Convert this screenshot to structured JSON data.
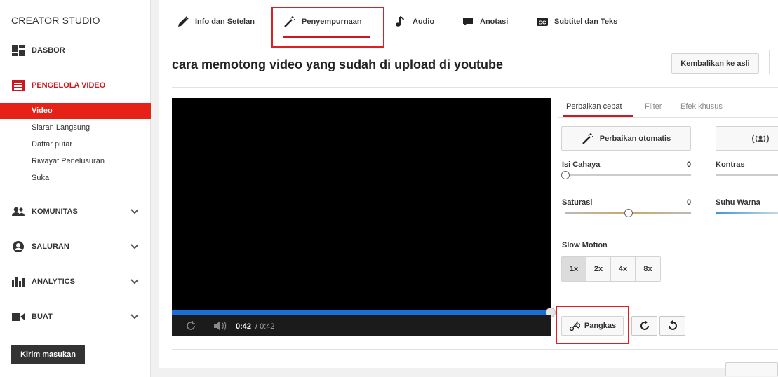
{
  "sidebar": {
    "brand": "CREATOR STUDIO",
    "items": [
      {
        "label": "DASBOR",
        "icon": "dashboard-icon"
      },
      {
        "label": "PENGELOLA VIDEO",
        "icon": "video-manager-icon"
      },
      {
        "label": "KOMUNITAS",
        "icon": "community-icon"
      },
      {
        "label": "SALURAN",
        "icon": "channel-icon"
      },
      {
        "label": "ANALYTICS",
        "icon": "analytics-icon"
      },
      {
        "label": "BUAT",
        "icon": "create-icon"
      }
    ],
    "sub_items": [
      "Video",
      "Siaran Langsung",
      "Daftar putar",
      "Riwayat Penelusuran",
      "Suka"
    ],
    "active_sub": "Video",
    "feedback_label": "Kirim masukan"
  },
  "tabs": [
    {
      "label": "Info dan Setelan",
      "icon": "pencil-icon"
    },
    {
      "label": "Penyempurnaan",
      "icon": "magic-wand-icon"
    },
    {
      "label": "Audio",
      "icon": "music-note-icon"
    },
    {
      "label": "Anotasi",
      "icon": "speech-bubble-icon"
    },
    {
      "label": "Subtitel dan Teks",
      "icon": "cc-icon"
    }
  ],
  "active_tab": "Penyempurnaan",
  "page": {
    "title": "cara memotong video yang sudah di upload di youtube",
    "revert_label": "Kembalikan ke asli"
  },
  "player": {
    "current_time": "0:42",
    "separator_duration": "/ 0:42",
    "progress": 1.0
  },
  "panel": {
    "tabs": [
      "Perbaikan cepat",
      "Filter",
      "Efek khusus"
    ],
    "auto_fix_label": "Perbaikan otomatis",
    "sliders": [
      {
        "label": "Isi Cahaya",
        "value": "0",
        "level": 0.0
      },
      {
        "label": "Saturasi",
        "value": "0",
        "level": 0.5
      }
    ],
    "sliders_right": [
      {
        "label": "Kontras"
      },
      {
        "label": "Suhu Warna"
      }
    ],
    "slow_motion_label": "Slow Motion",
    "speeds": [
      "1x",
      "2x",
      "4x",
      "8x"
    ],
    "selected_speed": "1x",
    "trim_label": "Pangkas"
  },
  "colors": {
    "accent_red": "#cc181e",
    "progress_blue": "#1a6fd6",
    "highlight_box": "#e02020"
  }
}
